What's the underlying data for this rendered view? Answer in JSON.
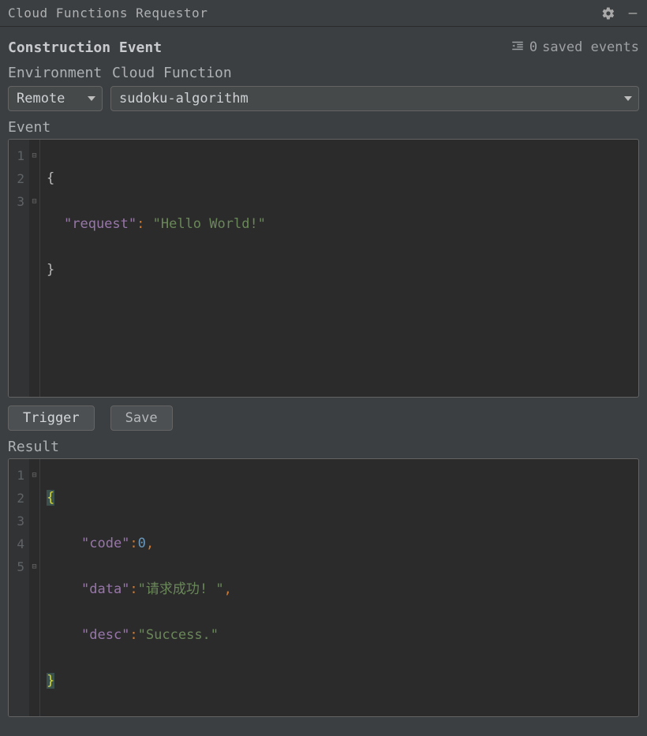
{
  "titlebar": {
    "title": "Cloud Functions Requestor"
  },
  "section": {
    "title": "Construction Event",
    "saved_events_count": "0",
    "saved_events_label": "saved events"
  },
  "labels": {
    "environment": "Environment",
    "cloud_function": "Cloud Function",
    "event": "Event",
    "result": "Result"
  },
  "controls": {
    "environment_value": "Remote",
    "function_value": "sudoku-algorithm"
  },
  "buttons": {
    "trigger": "Trigger",
    "save": "Save"
  },
  "event_editor": {
    "lines": [
      "1",
      "2",
      "3"
    ],
    "tokens": {
      "open": "{",
      "key_request": "\"request\"",
      "colon": ":",
      "val_hello": "\"Hello World!\"",
      "close": "}"
    }
  },
  "result_editor": {
    "lines": [
      "1",
      "2",
      "3",
      "4",
      "5"
    ],
    "tokens": {
      "open": "{",
      "key_code": "\"code\"",
      "val_code": "0",
      "key_data": "\"data\"",
      "val_data": "\"请求成功! \"",
      "key_desc": "\"desc\"",
      "val_desc": "\"Success.\"",
      "colon": ":",
      "comma": ",",
      "close": "}"
    }
  }
}
